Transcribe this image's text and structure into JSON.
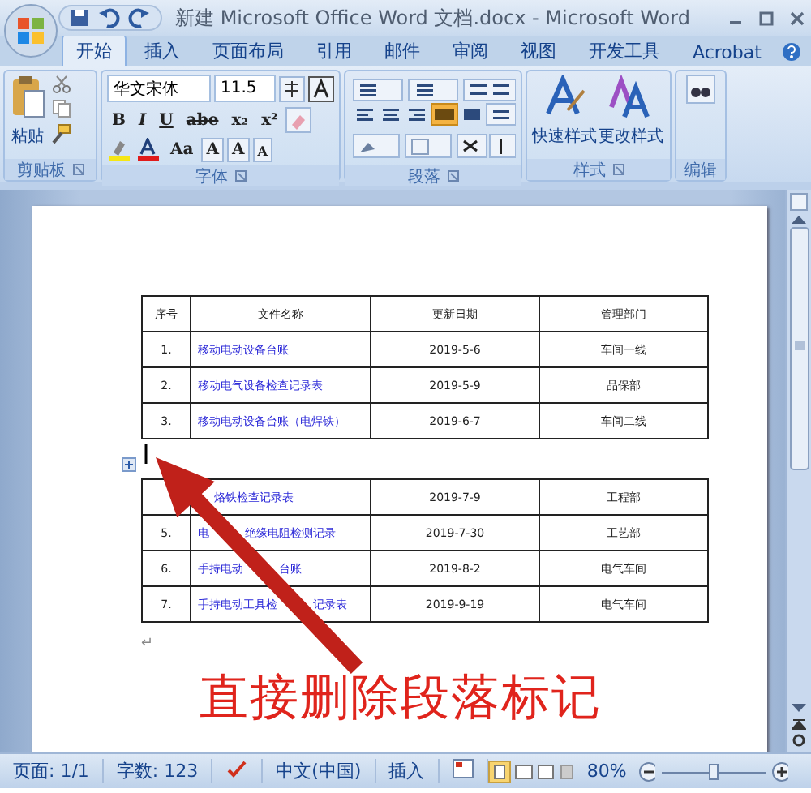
{
  "window": {
    "title": "新建 Microsoft Office Word 文档.docx - Microsoft Word"
  },
  "tabs": [
    {
      "label": "开始",
      "selected": true
    },
    {
      "label": "插入",
      "selected": false
    },
    {
      "label": "页面布局",
      "selected": false
    },
    {
      "label": "引用",
      "selected": false
    },
    {
      "label": "邮件",
      "selected": false
    },
    {
      "label": "审阅",
      "selected": false
    },
    {
      "label": "视图",
      "selected": false
    },
    {
      "label": "开发工具",
      "selected": false
    },
    {
      "label": "Acrobat",
      "selected": false
    }
  ],
  "ribbon": {
    "clipboard": {
      "label": "剪贴板",
      "paste": "粘贴"
    },
    "font": {
      "label": "字体",
      "font_name": "华文宋体",
      "font_size": "11.5",
      "buttons": [
        "B",
        "I",
        "U",
        "abe",
        "x₂",
        "x²"
      ],
      "size_buttons": [
        "Aa",
        "A",
        "A",
        "A"
      ]
    },
    "paragraph": {
      "label": "段落"
    },
    "styles": {
      "label": "样式",
      "buttons": [
        "快速样式",
        "更改样式"
      ]
    },
    "editing": {
      "label": "编辑"
    }
  },
  "tables": [
    {
      "header": [
        "序号",
        "文件名称",
        "更新日期",
        "管理部门"
      ],
      "rows": [
        [
          "1.",
          "移动电动设备台账",
          "2019-5-6",
          "车间一线"
        ],
        [
          "2.",
          "移动电气设备检查记录表",
          "2019-5-9",
          "品保部"
        ],
        [
          "3.",
          "移动电动设备台账（电焊铁）",
          "2019-6-7",
          "车间二线"
        ]
      ]
    },
    {
      "rows": [
        [
          null,
          [
            null,
            "烙铁检查记录表"
          ],
          "2019-7-9",
          "工程部"
        ],
        [
          "5.",
          [
            "电",
            null,
            "绝缘电阻检测记录"
          ],
          "2019-7-30",
          "工艺部"
        ],
        [
          "6.",
          [
            "手持电动",
            null,
            "台账"
          ],
          "2019-8-2",
          "电气车间"
        ],
        [
          "7.",
          [
            "手持电动工具检",
            null,
            "记录表"
          ],
          "2019-9-19",
          "电气车间"
        ]
      ]
    }
  ],
  "paragraph_mark": "↵",
  "annotation": "直接删除段落标记",
  "status_bar": {
    "page": "页面: 1/1",
    "words": "字数: 123",
    "language": "中文(中国)",
    "mode": "插入",
    "zoom": "80%",
    "zoom_slider": {
      "level": 0.5
    }
  }
}
